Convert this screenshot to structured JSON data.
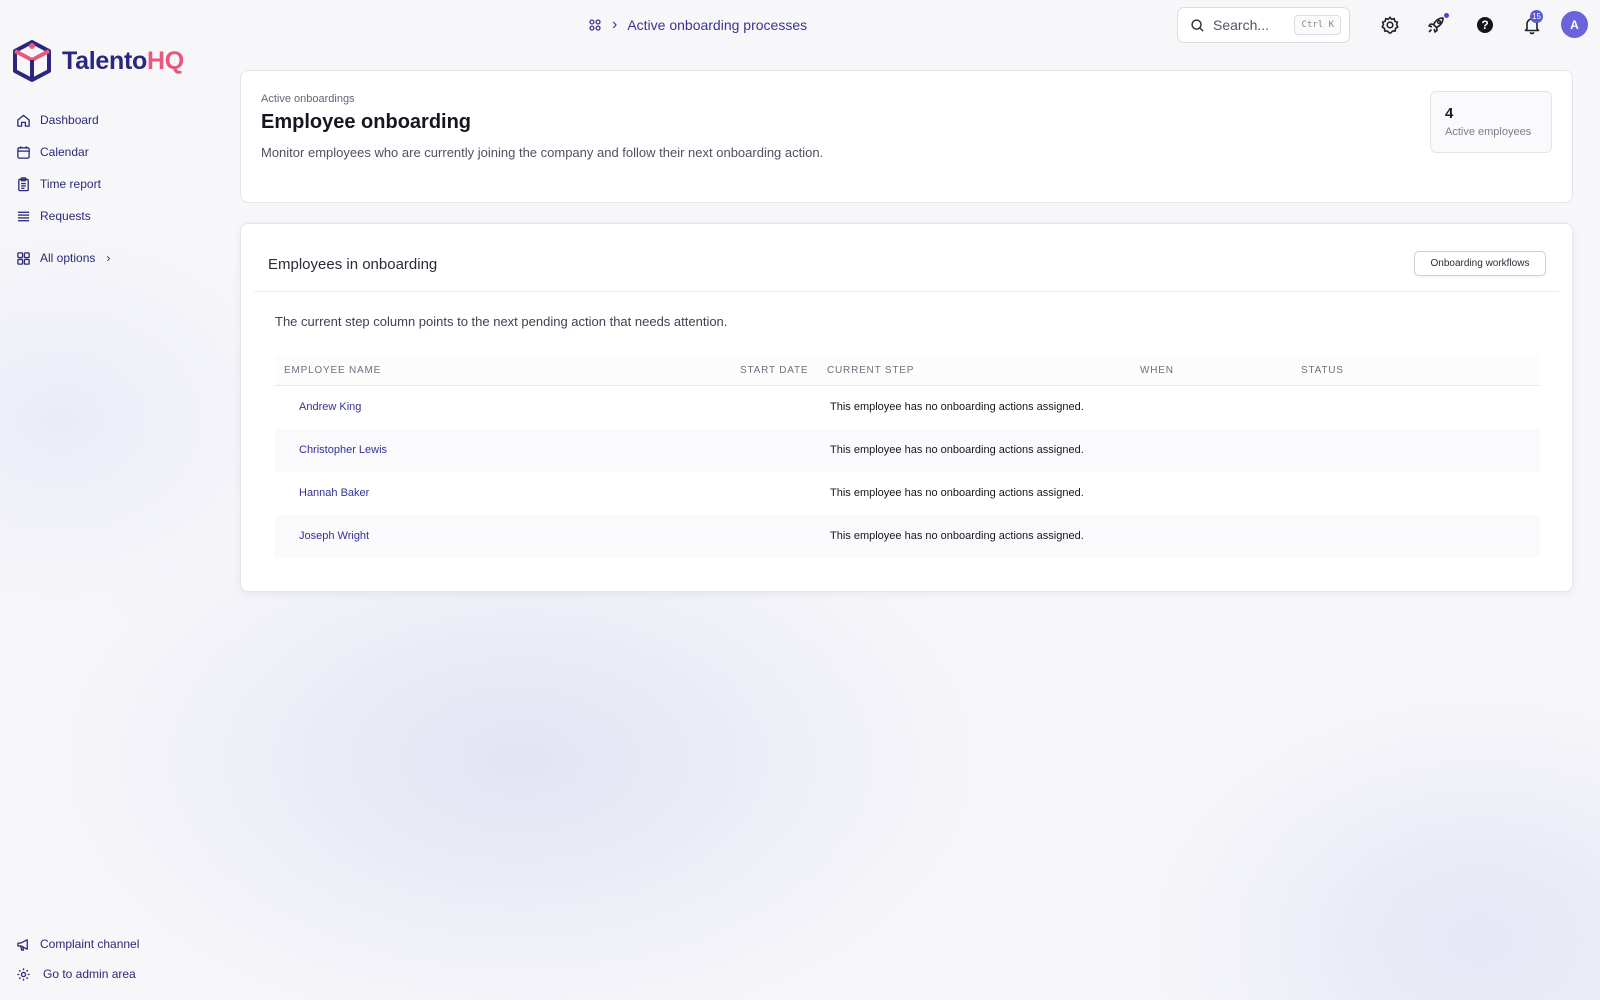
{
  "app": {
    "brand_part1": "Talento",
    "brand_part2": "HQ",
    "brand_colors": {
      "primary": "#2b2680",
      "accent": "#e8577d"
    }
  },
  "sidebar": {
    "items": [
      {
        "label": "Dashboard",
        "icon": "home-icon"
      },
      {
        "label": "Calendar",
        "icon": "calendar-icon"
      },
      {
        "label": "Time report",
        "icon": "clipboard-icon"
      },
      {
        "label": "Requests",
        "icon": "list-icon"
      },
      {
        "label": "All options",
        "icon": "grid-icon"
      }
    ],
    "bottom": [
      {
        "label": "Complaint channel",
        "icon": "megaphone-icon"
      },
      {
        "label": "Go to admin area",
        "icon": "gear-icon"
      }
    ]
  },
  "topbar": {
    "breadcrumb": "Active onboarding processes",
    "search_placeholder": "Search...",
    "search_shortcut": "Ctrl K",
    "notifications_count": "15",
    "avatar_initial": "A"
  },
  "header": {
    "eyebrow": "Active onboardings",
    "title": "Employee onboarding",
    "description": "Monitor employees who are currently joining the company and follow their next onboarding action.",
    "stat_value": "4",
    "stat_label": "Active employees"
  },
  "table_card": {
    "title": "Employees in onboarding",
    "workflows_button": "Onboarding workflows",
    "note": "The current step column points to the next pending action that needs attention.",
    "columns": [
      "EMPLOYEE NAME",
      "START DATE",
      "CURRENT STEP",
      "WHEN",
      "STATUS"
    ],
    "rows": [
      {
        "name": "Andrew King",
        "start_date": "",
        "current_step": "This employee has no onboarding actions assigned.",
        "when": "",
        "status": ""
      },
      {
        "name": "Christopher Lewis",
        "start_date": "",
        "current_step": "This employee has no onboarding actions assigned.",
        "when": "",
        "status": ""
      },
      {
        "name": "Hannah Baker",
        "start_date": "",
        "current_step": "This employee has no onboarding actions assigned.",
        "when": "",
        "status": ""
      },
      {
        "name": "Joseph Wright",
        "start_date": "",
        "current_step": "This employee has no onboarding actions assigned.",
        "when": "",
        "status": ""
      }
    ]
  }
}
